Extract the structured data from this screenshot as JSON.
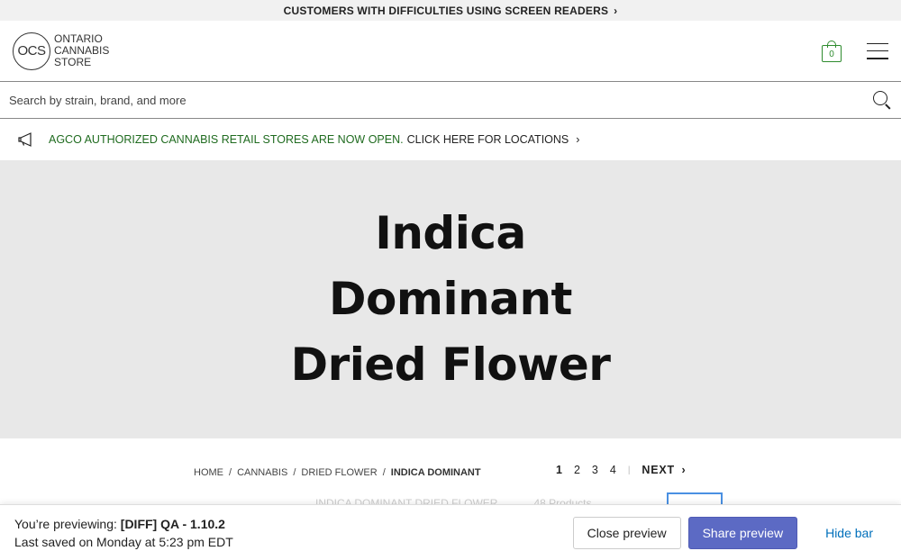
{
  "accessibility_bar": {
    "text": "CUSTOMERS WITH DIFFICULTIES USING SCREEN READERS",
    "chevron": "›"
  },
  "header": {
    "logo_mark": "OCS",
    "logo_lines": [
      "ONTARIO",
      "CANNABIS",
      "STORE"
    ],
    "cart_count": "0",
    "accent_color": "#2e8b2e"
  },
  "search": {
    "placeholder": "Search by strain, brand, and more"
  },
  "announcement": {
    "icon": "megaphone-icon",
    "green_text": "AGCO AUTHORIZED CANNABIS RETAIL STORES ARE NOW OPEN.",
    "link_text": "CLICK HERE FOR LOCATIONS",
    "chevron": "›"
  },
  "hero": {
    "title_lines": [
      "Indica",
      "Dominant",
      "Dried Flower"
    ]
  },
  "breadcrumb": [
    "HOME",
    "CANNABIS",
    "DRIED FLOWER",
    "INDICA DOMINANT"
  ],
  "pagination": {
    "pages": [
      "1",
      "2",
      "3",
      "4"
    ],
    "current": "1",
    "next_label": "NEXT",
    "chevron": "›"
  },
  "filter_row": {
    "category": "INDICA DOMINANT DRIED FLOWER",
    "count": "48 Products"
  },
  "preview_bar": {
    "label": "You’re previewing:",
    "theme": "[DIFF] QA - 1.10.2",
    "saved": "Last saved on Monday at 5:23 pm EDT",
    "close": "Close preview",
    "share": "Share preview",
    "hide": "Hide bar",
    "primary_color": "#5c6ac4"
  }
}
